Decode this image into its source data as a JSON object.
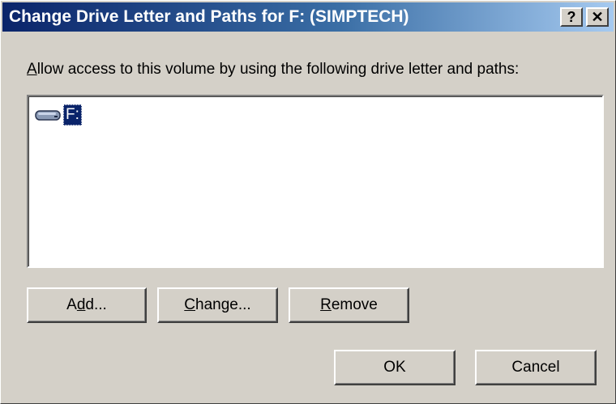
{
  "window": {
    "title": "Change Drive Letter and Paths for F: (SIMPTECH)",
    "help_label": "?",
    "close_label": "✕"
  },
  "instruction": {
    "prefix": "A",
    "rest": "llow access to this volume by using the following drive letter and paths:"
  },
  "list": {
    "items": [
      {
        "label": "F:",
        "icon": "drive-icon",
        "selected": true
      }
    ]
  },
  "buttons": {
    "add": {
      "mnemonic": "d",
      "before": "A",
      "after": "d..."
    },
    "change": {
      "mnemonic": "C",
      "before": "",
      "after": "hange..."
    },
    "remove": {
      "mnemonic": "R",
      "before": "",
      "after": "emove"
    },
    "ok": "OK",
    "cancel": "Cancel"
  },
  "colors": {
    "titlebar_start": "#0a246a",
    "titlebar_end": "#a6caf0",
    "selection": "#0a246a",
    "face": "#d4d0c8"
  }
}
